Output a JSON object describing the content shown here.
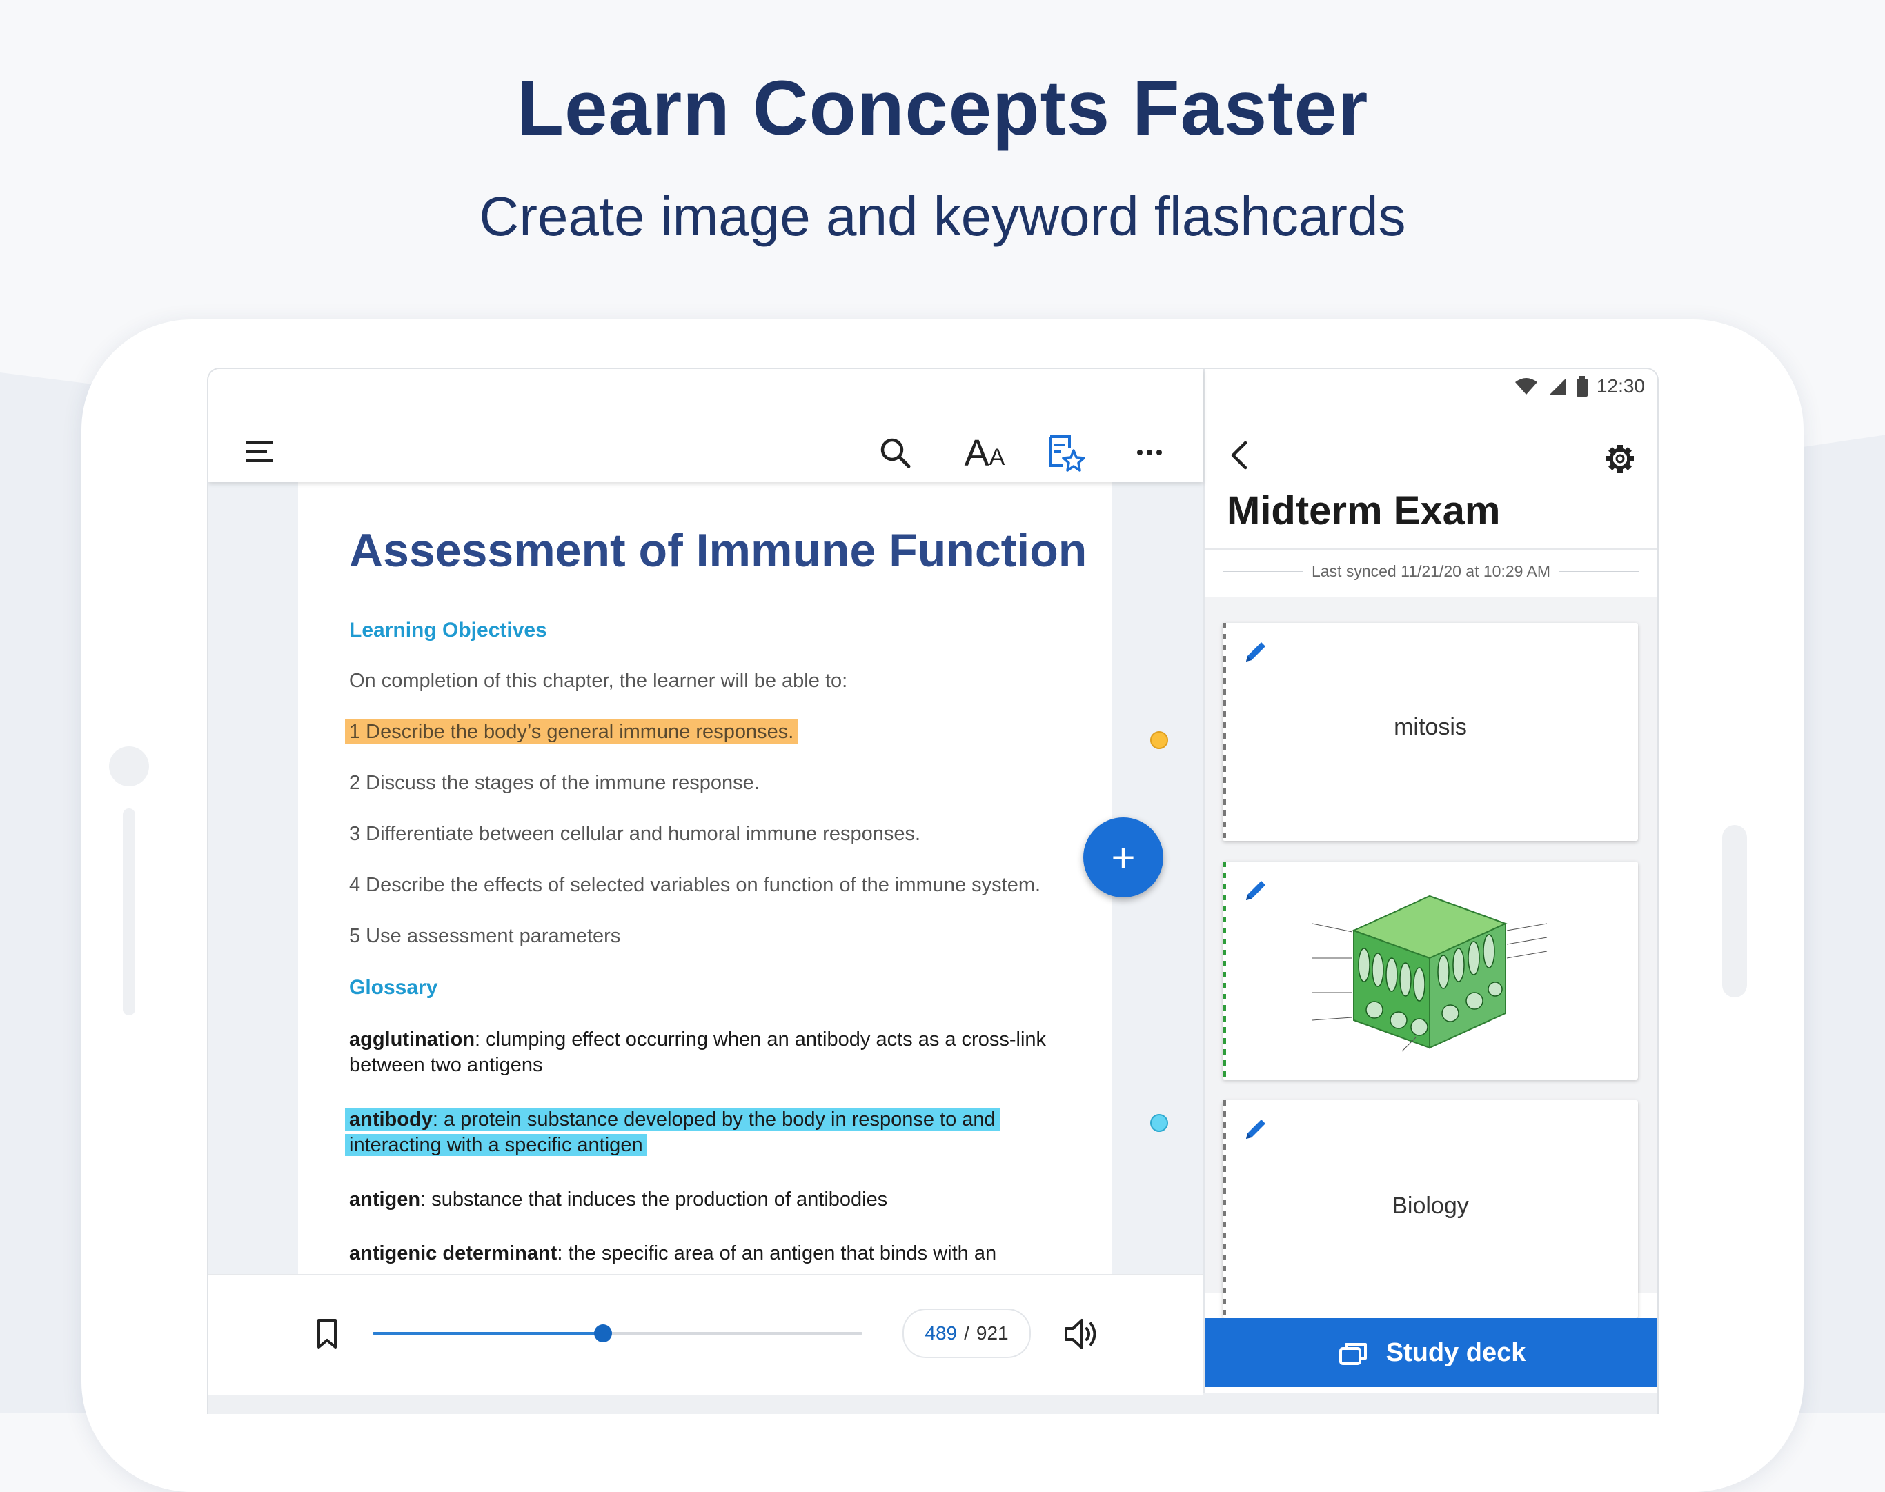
{
  "hero": {
    "title": "Learn Concepts Faster",
    "subtitle": "Create image and keyword flashcards"
  },
  "toolbar": {
    "icons": [
      "menu-icon",
      "search-icon",
      "text-size-icon",
      "flashcard-star-icon",
      "more-icon"
    ],
    "text_size_label": "AA"
  },
  "document": {
    "title": "Assessment of Immune Function",
    "objectives_heading": "Learning Objectives",
    "intro": "On completion of this chapter, the learner will be able to:",
    "objectives": [
      "1 Describe the body’s general immune responses.",
      "2 Discuss the stages of the immune response.",
      "3 Differentiate between cellular and humoral immune responses.",
      "4 Describe the effects of selected variables on function of the immune system.",
      "5 Use assessment parameters"
    ],
    "glossary_heading": "Glossary",
    "glossary": [
      {
        "term": "agglutination",
        "definition": ": clumping effect occurring when an antibody acts as a cross-link between two antigens"
      },
      {
        "term": "antibody",
        "definition": ": a protein substance developed by the body in response to and interacting with a specific antigen"
      },
      {
        "term": "antigen",
        "definition": ": substance that induces the production of antibodies"
      },
      {
        "term": "antigenic determinant",
        "definition": ": the specific area of an antigen that binds with an"
      }
    ],
    "highlight_colors": {
      "orange": "#fbbf6a",
      "cyan": "#64d5f3"
    }
  },
  "reader_bottom": {
    "current_page": "489",
    "separator": "/",
    "total_pages": "921",
    "progress": 0.471
  },
  "status": {
    "time": "12:30"
  },
  "deck": {
    "title": "Midterm Exam",
    "synced": "Last synced 11/21/20 at 10:29 AM",
    "cards": [
      {
        "label": "mitosis",
        "type": "keyword"
      },
      {
        "label": "",
        "type": "image",
        "image": "leaf-cross-section-diagram"
      },
      {
        "label": "Biology",
        "type": "keyword"
      }
    ],
    "fab_label": "+",
    "study_button": "Study deck"
  },
  "colors": {
    "navy": "#1e3466",
    "accent_blue": "#1a6fd6",
    "doc_title": "#2d4a8a",
    "section_cyan": "#1f9ad1"
  }
}
